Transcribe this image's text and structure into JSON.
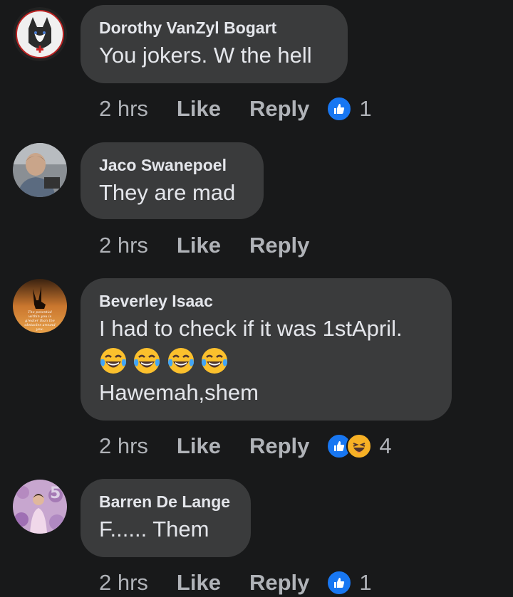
{
  "comments": [
    {
      "author": "Dorothy VanZyl Bogart",
      "text": "You jokers. W the hell",
      "time": "2 hrs",
      "like_label": "Like",
      "reply_label": "Reply",
      "reaction_count": "1"
    },
    {
      "author": "Jaco Swanepoel",
      "text": "They are mad",
      "time": "2 hrs",
      "like_label": "Like",
      "reply_label": "Reply"
    },
    {
      "author": "Beverley Isaac",
      "text": "I had to check if it was 1stApril.",
      "emoji": [
        "face-with-tears-of-joy",
        "face-with-tears-of-joy",
        "face-with-tears-of-joy",
        "face-with-tears-of-joy"
      ],
      "text2": "Hawemah,shem",
      "time": "2 hrs",
      "like_label": "Like",
      "reply_label": "Reply",
      "reaction_count": "4",
      "avatar_text": "The potential within you is greater than the obstacles around you."
    },
    {
      "author": "Barren De Lange",
      "text": "F...... Them",
      "time": "2 hrs",
      "like_label": "Like",
      "reply_label": "Reply",
      "reaction_count": "1"
    }
  ],
  "colors": {
    "background": "#18191a",
    "bubble": "#3a3b3c",
    "text": "#e4e6eb",
    "secondary": "#b0b3b8",
    "like_blue": "#1877f2",
    "haha_yellow": "#f7b125"
  }
}
